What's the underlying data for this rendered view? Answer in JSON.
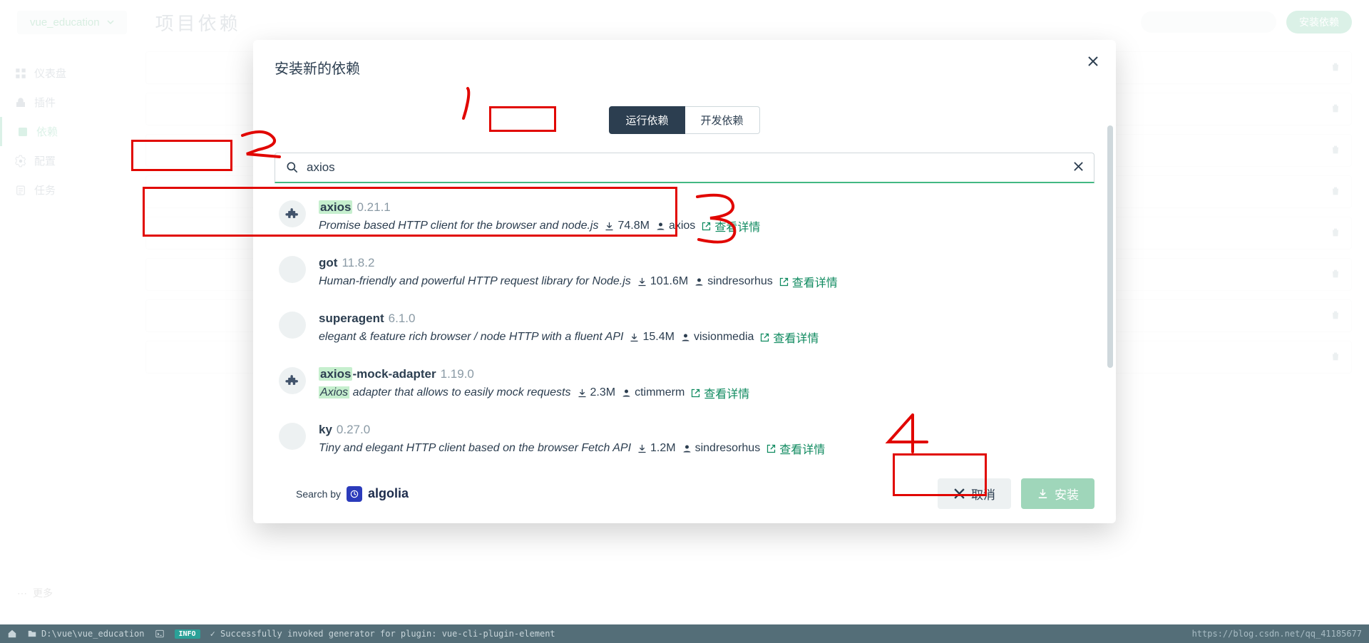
{
  "backdrop": {
    "project_name": "vue_education",
    "page_title": "项目依赖",
    "top_install": "安装依赖",
    "sidebar": [
      {
        "label": "仪表盘"
      },
      {
        "label": "插件"
      },
      {
        "label": "依赖"
      },
      {
        "label": "配置"
      },
      {
        "label": "任务"
      }
    ],
    "more": "更多"
  },
  "modal": {
    "title": "安装新的依赖",
    "tabs": {
      "runtime": "运行依赖",
      "dev": "开发依赖"
    },
    "search_value": "axios",
    "detail_label": "查看详情",
    "results": [
      {
        "name_pre": "",
        "name_hl": "axios",
        "name_post": "",
        "version": "0.21.1",
        "desc_pre": "Promise based HTTP client for the browser and node.js",
        "desc_hl": "",
        "desc_post": "",
        "downloads": "74.8M",
        "owner": "axios",
        "has_puzzle": true
      },
      {
        "name_pre": "got",
        "name_hl": "",
        "name_post": "",
        "version": "11.8.2",
        "desc_pre": "Human-friendly and powerful HTTP request library for Node.js",
        "desc_hl": "",
        "desc_post": "",
        "downloads": "101.6M",
        "owner": "sindresorhus",
        "has_puzzle": false
      },
      {
        "name_pre": "superagent",
        "name_hl": "",
        "name_post": "",
        "version": "6.1.0",
        "desc_pre": "elegant &amp; feature rich browser / node HTTP with a fluent API",
        "desc_hl": "",
        "desc_post": "",
        "downloads": "15.4M",
        "owner": "visionmedia",
        "has_puzzle": false
      },
      {
        "name_pre": "",
        "name_hl": "axios",
        "name_post": "-mock-adapter",
        "version": "1.19.0",
        "desc_pre": "",
        "desc_hl": "Axios",
        "desc_post": " adapter that allows to easily mock requests",
        "downloads": "2.3M",
        "owner": "ctimmerm",
        "has_puzzle": true
      },
      {
        "name_pre": "ky",
        "name_hl": "",
        "name_post": "",
        "version": "0.27.0",
        "desc_pre": "Tiny and elegant HTTP client based on the browser Fetch API",
        "desc_hl": "",
        "desc_post": "",
        "downloads": "1.2M",
        "owner": "sindresorhus",
        "has_puzzle": false
      }
    ],
    "search_by": "Search by",
    "algolia": "algolia",
    "cancel": "取消",
    "install": "安装"
  },
  "statusbar": {
    "path": "D:\\vue\\vue_education",
    "tag": "INFO",
    "msg": "✓ Successfully invoked generator for plugin: vue-cli-plugin-element",
    "url": "https://blog.csdn.net/qq_41185677"
  },
  "annotations": {
    "n1": "1",
    "n2": "2",
    "n3": "3",
    "n4": "4"
  }
}
